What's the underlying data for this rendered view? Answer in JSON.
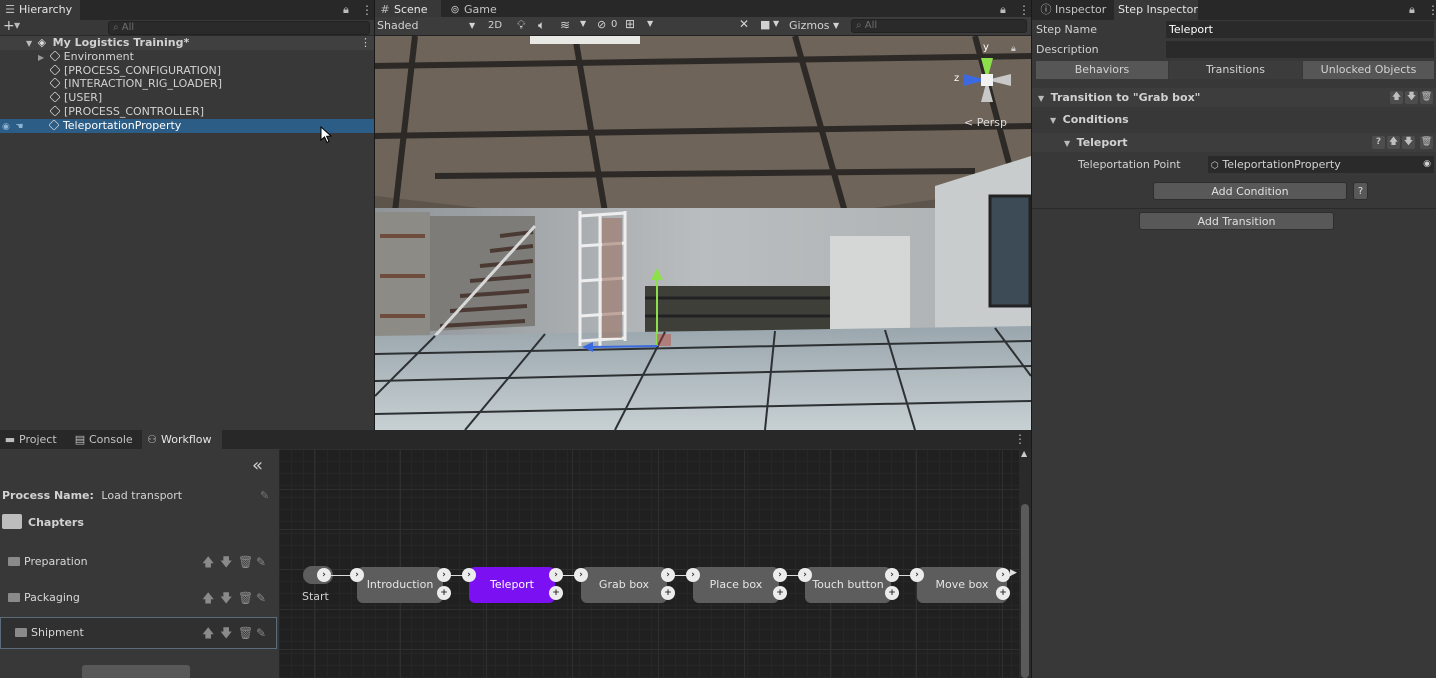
{
  "hierarchy": {
    "tab": "Hierarchy",
    "search_placeholder": "All",
    "root": "My Logistics Training*",
    "items": [
      "Environment",
      "[PROCESS_CONFIGURATION]",
      "[INTERACTION_RIG_LOADER]",
      "[USER]",
      "[PROCESS_CONTROLLER]",
      "TeleportationProperty"
    ],
    "selected": "TeleportationProperty"
  },
  "scene": {
    "tabs": [
      "Scene",
      "Game"
    ],
    "shading": "Shaded",
    "mode_2d": "2D",
    "hidden_count": "0",
    "gizmos": "Gizmos",
    "search_placeholder": "All",
    "gizmo_y": "y",
    "gizmo_z": "z",
    "projection": "< Persp"
  },
  "inspector": {
    "tabs": [
      "Inspector",
      "Step Inspector"
    ],
    "step_name_label": "Step Name",
    "step_name_value": "Teleport",
    "description_label": "Description",
    "subtabs": [
      "Behaviors",
      "Transitions",
      "Unlocked Objects"
    ],
    "active_subtab": "Transitions",
    "transition_title": "Transition to \"Grab box\"",
    "conditions_label": "Conditions",
    "condition_name": "Teleport",
    "teleport_point_label": "Teleportation Point",
    "teleport_point_value": "TeleportationProperty",
    "add_condition": "Add Condition",
    "help": "?",
    "add_transition": "Add Transition"
  },
  "bottom_tabs": [
    "Project",
    "Console",
    "Workflow"
  ],
  "workflow": {
    "process_name_label": "Process Name:",
    "process_name_value": "Load transport",
    "chapters_label": "Chapters",
    "chapters": [
      "Preparation",
      "Packaging",
      "Shipment"
    ],
    "selected_chapter": "Shipment",
    "start_label": "Start",
    "steps": [
      "Introduction",
      "Teleport",
      "Grab box",
      "Place box",
      "Touch button",
      "Move box"
    ],
    "active_step": "Teleport"
  },
  "colors": {
    "selection_blue": "#2c5d87",
    "active_step": "#7b10f3",
    "panel": "#383838"
  }
}
